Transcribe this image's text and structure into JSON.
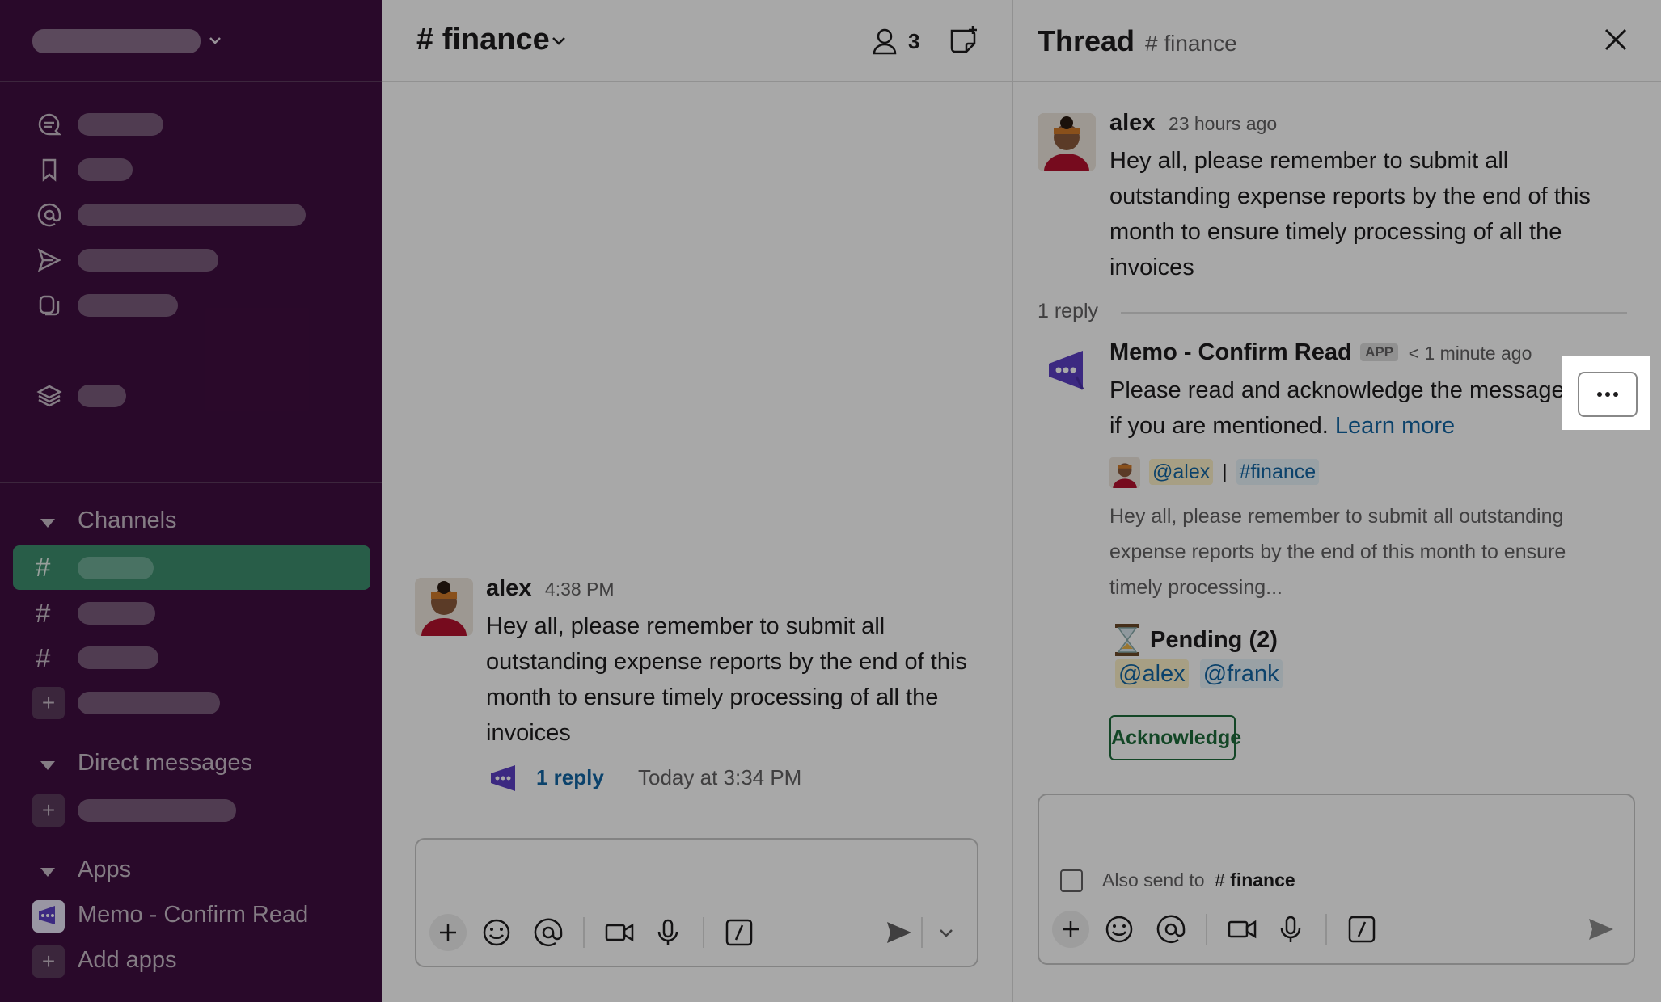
{
  "sidebar": {
    "sections": {
      "channels": "Channels",
      "direct_messages": "Direct messages",
      "apps": "Apps"
    },
    "apps": [
      {
        "label": "Memo - Confirm Read"
      }
    ],
    "add_apps": "Add apps"
  },
  "main": {
    "channel": "finance",
    "member_count": "3",
    "message": {
      "author": "alex",
      "time": "4:38 PM",
      "body": "Hey all, please remember to submit all outstanding expense reports by the end of this month to ensure timely processing of all the invoices",
      "reply_count": "1 reply",
      "reply_time": "Today at 3:34 PM"
    }
  },
  "thread": {
    "title": "Thread",
    "channel": "finance",
    "parent": {
      "author": "alex",
      "time": "23 hours ago",
      "body": "Hey all, please remember to submit all outstanding expense reports by the end of this month to ensure timely processing of all the invoices"
    },
    "reply_divider": "1 reply",
    "reply": {
      "author": "Memo - Confirm Read",
      "badge": "APP",
      "time": "< 1 minute ago",
      "body": "Please read and acknowledge the message if you are mentioned.",
      "learn_more": "Learn more",
      "ref_mention": "@alex",
      "ref_sep": "|",
      "ref_channel": "#finance",
      "quote": "Hey all, please remember to submit all outstanding expense reports by the end of this month to ensure timely processing...",
      "pending_label": "Pending (2)",
      "pending_users": [
        "@alex",
        "@frank"
      ],
      "ack_button": "Acknowledge"
    },
    "composer": {
      "also_send_prefix": "Also send to",
      "also_send_channel": "finance"
    }
  },
  "colors": {
    "sidebar_bg": "#3f0e40",
    "active_channel": "#3e8e6e",
    "link": "#1264a3",
    "ack_green": "#1e6b3a"
  }
}
